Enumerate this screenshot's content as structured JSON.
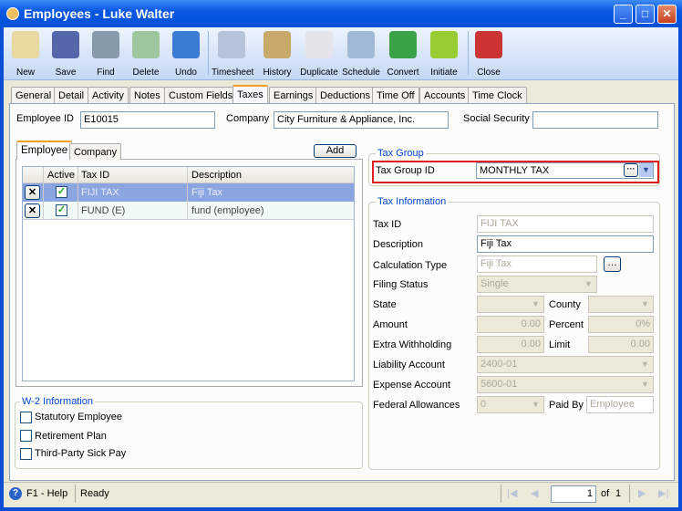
{
  "window": {
    "title": "Employees - Luke  Walter"
  },
  "toolbar": [
    {
      "label": "New",
      "icon": "new-icon"
    },
    {
      "label": "Save",
      "icon": "save-icon"
    },
    {
      "label": "Find",
      "icon": "find-icon"
    },
    {
      "label": "Delete",
      "icon": "delete-icon"
    },
    {
      "label": "Undo",
      "icon": "undo-icon"
    },
    {
      "label": "Timesheet",
      "icon": "timesheet-icon"
    },
    {
      "label": "History",
      "icon": "history-icon"
    },
    {
      "label": "Duplicate",
      "icon": "duplicate-icon"
    },
    {
      "label": "Schedule",
      "icon": "schedule-icon"
    },
    {
      "label": "Convert",
      "icon": "convert-icon"
    },
    {
      "label": "Initiate",
      "icon": "initiate-icon"
    },
    {
      "label": "Close",
      "icon": "close-icon"
    }
  ],
  "tabs": [
    "General",
    "Detail",
    "Activity",
    "Notes",
    "Custom Fields",
    "Taxes",
    "Earnings",
    "Deductions",
    "Time Off",
    "Accounts",
    "Time Clock"
  ],
  "active_tab": "Taxes",
  "header": {
    "employee_id_label": "Employee ID",
    "employee_id": "E10015",
    "company_label": "Company",
    "company": "City Furniture & Appliance, Inc.",
    "ssn_label": "Social Security",
    "ssn": ""
  },
  "subtabs": [
    "Employee",
    "Company"
  ],
  "add_label": "Add",
  "grid": {
    "columns": [
      "Active",
      "Tax ID",
      "Description"
    ],
    "rows": [
      {
        "active": true,
        "tax_id": "FIJI TAX",
        "description": "Fiji Tax",
        "selected": true
      },
      {
        "active": true,
        "tax_id": "FUND (E)",
        "description": "fund (employee)",
        "selected": false
      }
    ]
  },
  "w2": {
    "title": "W-2 Information",
    "items": [
      {
        "label": "Statutory Employee",
        "checked": false
      },
      {
        "label": "Retirement Plan",
        "checked": false
      },
      {
        "label": "Third-Party Sick Pay",
        "checked": false
      }
    ]
  },
  "tax_group": {
    "title": "Tax Group",
    "label": "Tax Group ID",
    "value": "MONTHLY TAX"
  },
  "tax_info": {
    "title": "Tax Information",
    "tax_id_label": "Tax ID",
    "tax_id": "FIJI TAX",
    "description_label": "Description",
    "description": "Fiji Tax",
    "calc_type_label": "Calculation Type",
    "calc_type": "Fiji Tax",
    "filing_status_label": "Filing Status",
    "filing_status": "Single",
    "state_label": "State",
    "state": "",
    "county_label": "County",
    "county": "",
    "amount_label": "Amount",
    "amount": "0.00",
    "percent_label": "Percent",
    "percent": "0%",
    "extra_label": "Extra Withholding",
    "extra": "0.00",
    "limit_label": "Limit",
    "limit": "0.00",
    "liability_label": "Liability Account",
    "liability": "2400-01",
    "expense_label": "Expense Account",
    "expense": "5600-01",
    "fed_allow_label": "Federal Allowances",
    "fed_allow": "0",
    "paid_by_label": "Paid By",
    "paid_by": "Employee"
  },
  "status": {
    "help": "F1 - Help",
    "text": "Ready",
    "page": "1",
    "of": "of",
    "total": "1"
  },
  "colors": {
    "title_bar": "#0a58e2",
    "selected_row": "#8aa5e0",
    "highlight_border": "#e02020",
    "group_label": "#0046d5"
  }
}
